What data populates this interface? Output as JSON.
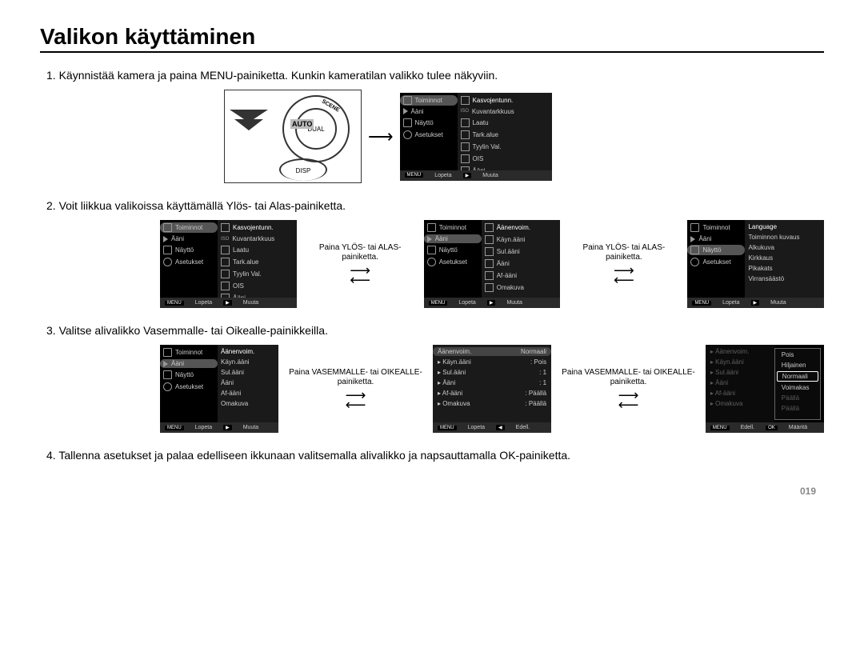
{
  "title": "Valikon käyttäminen",
  "step1": "1. Käynnistää kamera ja paina MENU-painiketta.  Kunkin kameratilan valikko tulee näkyviin.",
  "step2": "2. Voit liikkua valikoissa käyttämällä Ylös- tai Alas-painiketta.",
  "step3": "3. Valitse alivalikko Vasemmalle- tai Oikealle-painikkeilla.",
  "step4": "4. Tallenna asetukset ja palaa edelliseen ikkunaan valitsemalla alivalikko ja napsauttamalla OK-painiketta.",
  "cam_illus": {
    "auto": "AUTO",
    "scene": "SCENE",
    "dual": "DUAL",
    "disp": "DISP"
  },
  "caption_updown": "Paina YLÖS- tai ALAS- painiketta.",
  "caption_leftright": "Paina VASEMMALLE- tai OIKEALLE- painiketta.",
  "left_menu": {
    "items": [
      "Toiminnot",
      "Ääni",
      "Näyttö",
      "Asetukset"
    ]
  },
  "right_menu_a": [
    "Kasvojentunn.",
    "Kuvantarkkuus",
    "Laatu",
    "Tark.alue",
    "Tyylin Val.",
    "OIS",
    "Ääni"
  ],
  "right_menu_b": [
    "Äänenvoim.",
    "Käyn.ääni",
    "Sul.ääni",
    "Ääni",
    "Af-ääni",
    "Omakuva"
  ],
  "right_menu_c": [
    "Language",
    "Toiminnon kuvaus",
    "Alkukuva",
    "Kirkkaus",
    "Pikakats",
    "Virransäästö"
  ],
  "val_menu_d": [
    {
      "k": "Äänenvoim.",
      "v": "Normaali"
    },
    {
      "k": "Käyn.ääni",
      "v": "Pois"
    },
    {
      "k": "Sul.ääni",
      "v": "1"
    },
    {
      "k": "Ääni",
      "v": "1"
    },
    {
      "k": "Af-ääni",
      "v": "Päällä"
    },
    {
      "k": "Omakuva",
      "v": "Päällä"
    }
  ],
  "val_menu_e": [
    {
      "k": "Äänenvoim.",
      "v": "Pois"
    },
    {
      "k": "Käyn.ääni",
      "v": "Hiljainen"
    },
    {
      "k": "Sul.ääni",
      "v": "Normaali"
    },
    {
      "k": "Ääni",
      "v": "Voimakas"
    },
    {
      "k": "Af-ääni",
      "v": "Päällä"
    },
    {
      "k": "Omakuva",
      "v": "Päällä"
    }
  ],
  "foot": {
    "menu": "MENU",
    "lopeta": "Lopeta",
    "play": "▶",
    "muuta": "Muuta",
    "edell": "Edell.",
    "ok": "OK",
    "maarita": "Määritä",
    "left": "◀"
  },
  "iso_label": "ISO",
  "page_num": "019"
}
